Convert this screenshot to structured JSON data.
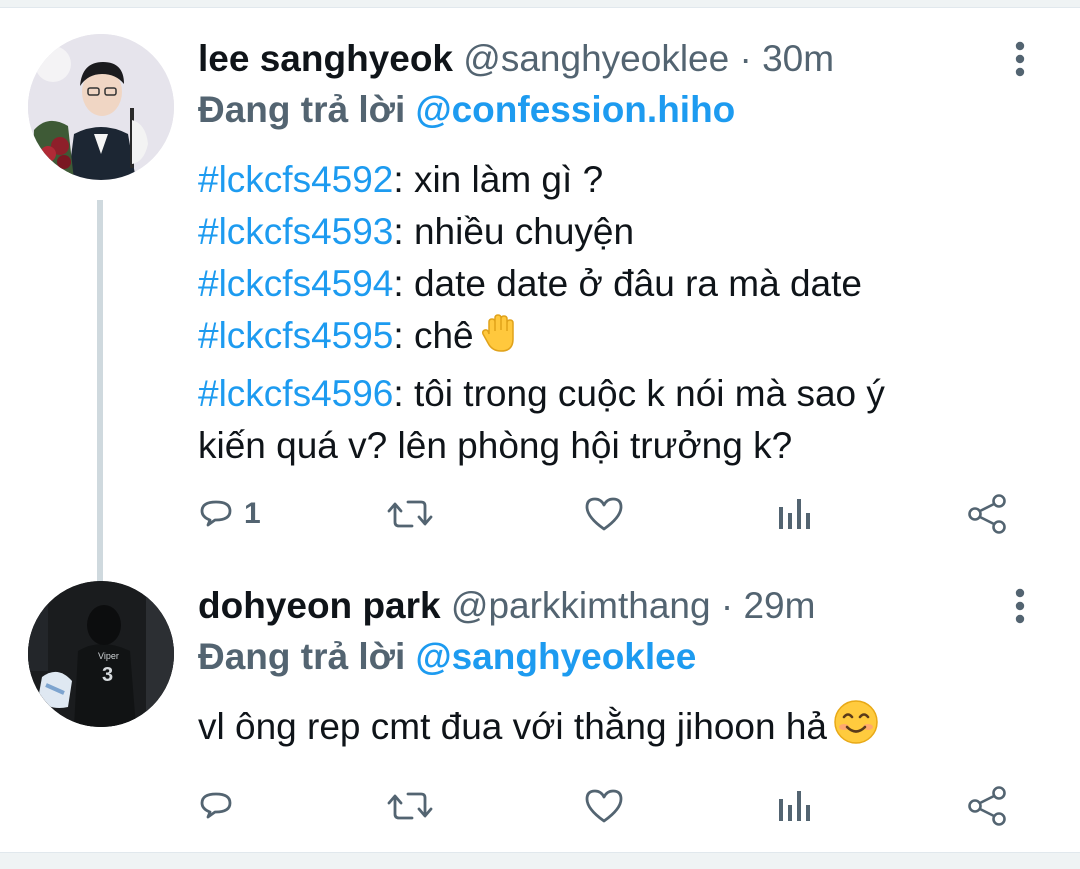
{
  "tweets": [
    {
      "author_name": "lee sanghyeok",
      "author_handle": "@sanghyeoklee",
      "separator": "·",
      "time": "30m",
      "reply_prefix": "Đang trả lời",
      "reply_to": "@confession.hiho",
      "lines": [
        {
          "tag": "#lckcfs4592",
          "text": ": xin làm gì ?"
        },
        {
          "tag": "#lckcfs4593",
          "text": ": nhiều chuyện"
        },
        {
          "tag": "#lckcfs4594",
          "text": ": date date ở đâu ra mà date"
        },
        {
          "tag": "#lckcfs4595",
          "text": ": chê",
          "emoji": "raised-hand-emoji"
        },
        {
          "tag": "#lckcfs4596",
          "text": ": tôi trong cuộc k nói mà sao ý"
        },
        {
          "tag": "",
          "text": "kiến quá v? lên phòng hội trưởng k?"
        }
      ],
      "reply_count": "1"
    },
    {
      "author_name": "dohyeon park",
      "author_handle": "@parkkimthang",
      "separator": "·",
      "time": "29m",
      "reply_prefix": "Đang trả lời",
      "reply_to": "@sanghyeoklee",
      "text": "vl ông rep cmt đua với thằng jihoon hả",
      "emoji": "smiling-face-emoji",
      "jersey_text": "Viper",
      "jersey_number": "3",
      "reply_count": ""
    }
  ],
  "colors": {
    "link": "#1d9bf0",
    "secondary": "#536471",
    "primary": "#0f1419",
    "divider": "#eff3f4"
  },
  "icons": [
    "reply-icon",
    "retweet-icon",
    "like-icon",
    "stats-icon",
    "share-icon",
    "more-icon"
  ]
}
